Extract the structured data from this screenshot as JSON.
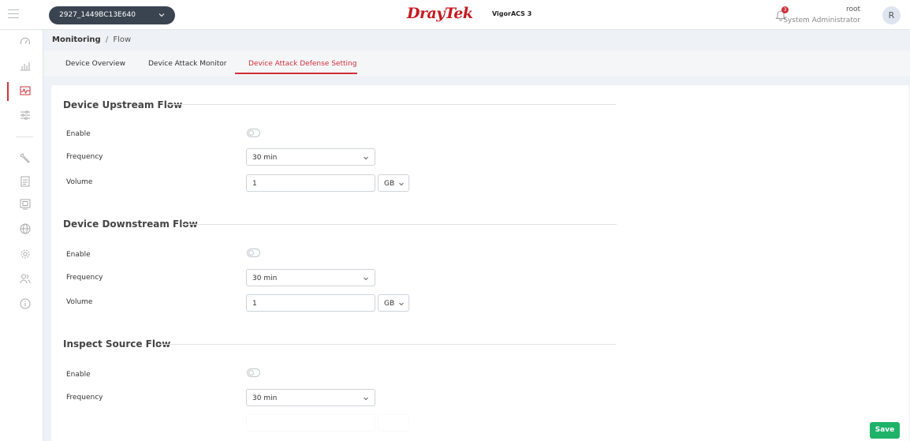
{
  "header": {
    "device_id": "2927_1449BC13E640",
    "brand_dray": "Dray",
    "brand_tek": "Tek",
    "product": "VigorACS 3",
    "notification_count": "3",
    "user_name": "root",
    "user_role": "System Administrator",
    "avatar_initial": "R"
  },
  "sidebar": {
    "items": [
      {
        "icon": "dashboard-gauge-icon"
      },
      {
        "icon": "bar-chart-icon"
      },
      {
        "icon": "monitoring-icon",
        "active": true
      },
      {
        "icon": "sliders-icon"
      },
      {
        "icon": "wrench-icon"
      },
      {
        "icon": "report-icon"
      },
      {
        "icon": "device-icon"
      },
      {
        "icon": "globe-icon"
      },
      {
        "icon": "settings-gear-icon"
      },
      {
        "icon": "users-icon"
      },
      {
        "icon": "info-icon"
      }
    ]
  },
  "breadcrumb": {
    "parent": "Monitoring",
    "separator": "/",
    "current": "Flow"
  },
  "tabs": [
    {
      "label": "Device Overview"
    },
    {
      "label": "Device Attack Monitor"
    },
    {
      "label": "Device Attack Defense Setting",
      "active": true
    }
  ],
  "sections": [
    {
      "title": "Device Upstream Flow",
      "enable_label": "Enable",
      "enabled": false,
      "frequency_label": "Frequency",
      "frequency_value": "30 min",
      "volume_label": "Volume",
      "volume_value": "1",
      "volume_unit": "GB"
    },
    {
      "title": "Device Downstream Flow",
      "enable_label": "Enable",
      "enabled": false,
      "frequency_label": "Frequency",
      "frequency_value": "30 min",
      "volume_label": "Volume",
      "volume_value": "1",
      "volume_unit": "GB"
    },
    {
      "title": "Inspect Source Flow",
      "enable_label": "Enable",
      "enabled": false,
      "frequency_label": "Frequency",
      "frequency_value": "30 min"
    }
  ],
  "actions": {
    "save_label": "Save"
  },
  "colors": {
    "accent": "#d0303a",
    "save": "#1fb36a",
    "device_pill": "#3a4451"
  }
}
